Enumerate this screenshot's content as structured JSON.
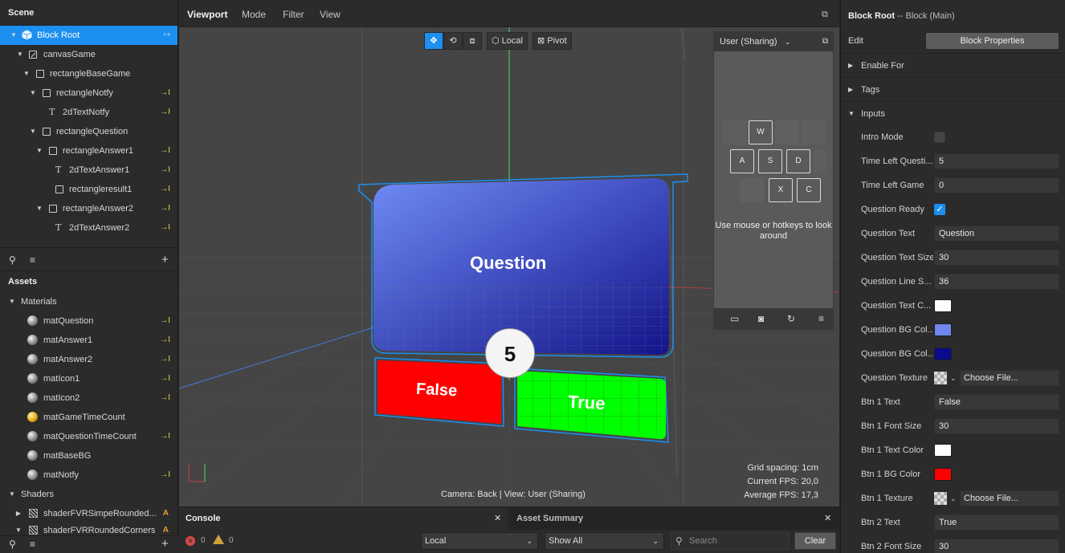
{
  "scene": {
    "title": "Scene",
    "nodes": [
      {
        "name": "Block Root",
        "icon": "cube-icon",
        "selected": true
      },
      {
        "name": "canvasGame",
        "icon": "canvas-icon"
      },
      {
        "name": "rectangleBaseGame",
        "icon": "rectangle-icon"
      },
      {
        "name": "rectangleNotfy",
        "icon": "rectangle-icon"
      },
      {
        "name": "2dTextNotfy",
        "icon": "text-icon"
      },
      {
        "name": "rectangleQuestion",
        "icon": "rectangle-icon"
      },
      {
        "name": "rectangleAnswer1",
        "icon": "rectangle-icon"
      },
      {
        "name": "2dTextAnswer1",
        "icon": "text-icon"
      },
      {
        "name": "rectangleresult1",
        "icon": "rectangle-icon"
      },
      {
        "name": "rectangleAnswer2",
        "icon": "rectangle-icon"
      },
      {
        "name": "2dTextAnswer2",
        "icon": "text-icon"
      }
    ]
  },
  "assets": {
    "title": "Assets",
    "materials_label": "Materials",
    "materials": [
      "matQuestion",
      "matAnswer1",
      "matAnswer2",
      "matIcon1",
      "matIcon2",
      "matGameTimeCount",
      "matQuestionTimeCount",
      "matBaseBG",
      "matNotfy"
    ],
    "shaders_label": "Shaders",
    "shaders": [
      "shaderFVRSimpeRounded...",
      "shaderFVRRoundedCorners"
    ],
    "shader_badge": "A"
  },
  "viewport": {
    "tabs": [
      "Viewport",
      "Mode",
      "Filter",
      "View"
    ],
    "local_label": "Local",
    "pivot_label": "Pivot",
    "question_label": "Question",
    "timer_value": "5",
    "false_label": "False",
    "true_label": "True",
    "camera_info": "Camera: Back | View: User (Sharing)",
    "grid_spacing": "Grid spacing: 1cm",
    "current_fps": "Current FPS:  20,0",
    "average_fps": "Average FPS:  17,3",
    "colors": {
      "question_top": "#6e8bf5",
      "question_bottom": "#13138a",
      "false": "#ff0000",
      "true": "#00ff00",
      "selection": "#1c8ff0"
    }
  },
  "camera_overlay": {
    "title": "User (Sharing)",
    "keys": [
      "W",
      "A",
      "S",
      "D",
      "X",
      "C"
    ],
    "tip": "Use mouse or hotkeys to look around"
  },
  "console": {
    "tab": "Console",
    "asset_tab": "Asset Summary",
    "error_count": "0",
    "warning_count": "0",
    "scope": "Local",
    "filter": "Show All",
    "search_placeholder": "Search",
    "clear_label": "Clear"
  },
  "inspector": {
    "title": "Block Root",
    "subtitle": "-- Block (Main)",
    "edit_label": "Edit",
    "block_properties_label": "Block Properties",
    "sections": [
      "Enable For",
      "Tags",
      "Inputs"
    ],
    "props": [
      {
        "label": "Intro Mode",
        "type": "check",
        "checked": false
      },
      {
        "label": "Time Left Questi...",
        "type": "text",
        "value": "5"
      },
      {
        "label": "Time Left Game",
        "type": "text",
        "value": "0"
      },
      {
        "label": "Question Ready",
        "type": "check",
        "checked": true
      },
      {
        "label": "Question Text",
        "type": "text",
        "value": "Question"
      },
      {
        "label": "Question Text Size",
        "type": "text",
        "value": "30"
      },
      {
        "label": "Question Line S...",
        "type": "text",
        "value": "36"
      },
      {
        "label": "Question Text C...",
        "type": "color",
        "value": "#ffffff"
      },
      {
        "label": "Question BG Col...",
        "type": "color",
        "value": "#6f86f0"
      },
      {
        "label": "Question BG Col...",
        "type": "color",
        "value": "#0a0a8a"
      },
      {
        "label": "Question Texture",
        "type": "texture",
        "value": "Choose File..."
      },
      {
        "label": "Btn 1 Text",
        "type": "text",
        "value": "False"
      },
      {
        "label": "Btn 1 Font Size",
        "type": "text",
        "value": "30"
      },
      {
        "label": "Btn 1 Text Color",
        "type": "color",
        "value": "#ffffff"
      },
      {
        "label": "Btn 1 BG Color",
        "type": "color",
        "value": "#ff0000"
      },
      {
        "label": "Btn 1 Texture",
        "type": "texture",
        "value": "Choose File..."
      },
      {
        "label": "Btn 2 Text",
        "type": "text",
        "value": "True"
      },
      {
        "label": "Btn 2 Font Size",
        "type": "text",
        "value": "30"
      }
    ]
  }
}
